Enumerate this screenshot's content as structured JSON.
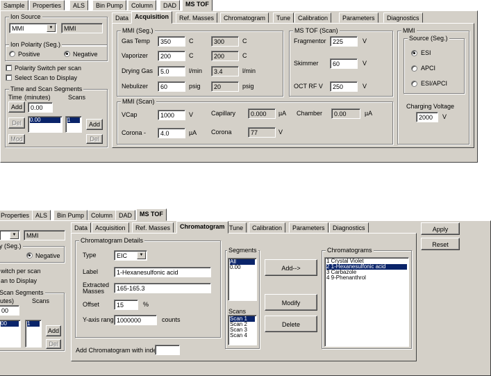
{
  "top": {
    "main_tabs": [
      "Sample",
      "Properties",
      "ALS",
      "Bin Pump",
      "Column",
      "DAD",
      "MS TOF"
    ],
    "left": {
      "ion_source_legend": "Ion Source",
      "ion_source_value": "MMI",
      "ion_source_readback": "MMI",
      "polarity_legend": "Ion Polarity (Seg.)",
      "polarity_positive": "Positive",
      "polarity_negative": "Negative",
      "polarity_switch": "Polarity Switch per scan",
      "select_scan": "Select Scan to Display",
      "segments_legend": "Time and Scan Segments",
      "time_label": "Time",
      "time_unit": "(minutes)",
      "scans_label": "Scans",
      "add_label": "Add",
      "time_value": "0.00",
      "del_label": "Del",
      "seg_time": "0.00",
      "seg_scans": "1",
      "add2_label": "Add",
      "mod_label": "Mod",
      "del2_label": "Del"
    },
    "sub_tabs": [
      "Data",
      "Acquisition",
      "Ref. Masses",
      "Chromatogram",
      "Tune",
      "Calibration",
      "Parameters",
      "Diagnostics"
    ],
    "mmi_seg": {
      "legend": "MMI (Seg.)",
      "rows": [
        {
          "label": "Gas Temp",
          "value": "350",
          "unit": "C",
          "actual": "300",
          "aunit": "C"
        },
        {
          "label": "Vaporizer",
          "value": "200",
          "unit": "C",
          "actual": "200",
          "aunit": "C"
        },
        {
          "label": "Drying Gas",
          "value": "5.0",
          "unit": "l/min",
          "actual": "3.4",
          "aunit": "l/min"
        },
        {
          "label": "Nebulizer",
          "value": "60",
          "unit": "psig",
          "actual": "20",
          "aunit": "psig"
        }
      ]
    },
    "mstof": {
      "legend": "MS TOF (Scan)",
      "rows": [
        {
          "label": "Fragmentor",
          "value": "225",
          "unit": "V"
        },
        {
          "label": "Skimmer",
          "value": "60",
          "unit": "V"
        },
        {
          "label": "OCT RF V",
          "value": "250",
          "unit": "V"
        }
      ]
    },
    "mmi_scan": {
      "legend": "MMI (Scan)",
      "vcap_label": "VCap",
      "vcap_value": "1000",
      "vcap_unit": "V",
      "capillary_label": "Capillary",
      "capillary_value": "0.000",
      "capillary_unit": "µA",
      "chamber_label": "Chamber",
      "chamber_value": "0.00",
      "chamber_unit": "µA",
      "corona_label": "Corona -",
      "corona_value": "4.0",
      "corona_unit": "µA",
      "corona2_label": "Corona",
      "corona2_value": "77",
      "corona2_unit": "V"
    },
    "mmi_right": {
      "legend": "MMI",
      "source_legend": "Source (Seg.)",
      "options": [
        "ESI",
        "APCI",
        "ESI/APCI"
      ],
      "charging_label": "Charging Voltage",
      "charging_value": "2000",
      "charging_unit": "V"
    }
  },
  "bottom": {
    "main_tabs": [
      "Properties",
      "ALS",
      "Bin Pump",
      "Column",
      "DAD",
      "MS TOF"
    ],
    "left": {
      "ion_source_value": "MMI",
      "polarity_fragment": "y (Seg.)",
      "polarity_negative": "Negative",
      "switch_fragment": "witch per scan",
      "display_fragment": "an to Display",
      "segments_fragment": "Scan Segments",
      "time_fragment": "utes)",
      "scans_label": "Scans",
      "time_value": "00",
      "seg_time": "00",
      "seg_scans": "1",
      "add_label": "Add",
      "del_label": "Del"
    },
    "sub_tabs": [
      "Data",
      "Acquisition",
      "Ref. Masses",
      "Chromatogram",
      "Tune",
      "Calibration",
      "Parameters",
      "Diagnostics"
    ],
    "details": {
      "legend": "Chromatogram Details",
      "type_label": "Type",
      "type_value": "EIC",
      "label_label": "Label",
      "label_value": "1-Hexanesulfonic acid",
      "extracted_label_1": "Extracted",
      "extracted_label_2": "Masses",
      "extracted_value": "165-165.3",
      "offset_label": "Offset",
      "offset_value": "15",
      "offset_unit": "%",
      "yrange_label": "Y-axis range",
      "yrange_value": "1000000",
      "yrange_unit": "counts",
      "add_index_label": "Add Chromatogram with index"
    },
    "segments": {
      "legend": "Segments",
      "items": [
        "All",
        "0.00"
      ]
    },
    "scans": {
      "legend": "Scans",
      "items": [
        "Scan 1",
        "Scan 2",
        "Scan 3",
        "Scan 4"
      ]
    },
    "actions": {
      "add": "Add-->",
      "modify": "Modify",
      "delete": "Delete"
    },
    "chromatograms": {
      "legend": "Chromatograms",
      "items": [
        "1 Crystal Violet",
        "2 1-Hexanesulfonic acid",
        "3 Carbazole",
        "4 9-Phenanthrol"
      ]
    },
    "apply_label": "Apply",
    "reset_label": "Reset"
  }
}
